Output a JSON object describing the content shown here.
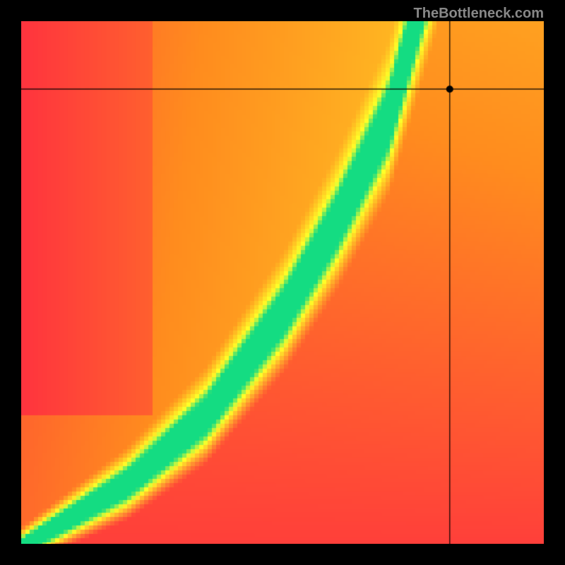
{
  "watermark": "TheBottleneck.com",
  "chart_data": {
    "type": "heatmap",
    "title": "",
    "xlabel": "",
    "ylabel": "",
    "xlim": [
      0,
      100
    ],
    "ylim": [
      0,
      100
    ],
    "colorscale": [
      {
        "value": 0,
        "color": "#ff2040"
      },
      {
        "value": 40,
        "color": "#ff8020"
      },
      {
        "value": 60,
        "color": "#ffff20"
      },
      {
        "value": 80,
        "color": "#10e080"
      },
      {
        "value": 100,
        "color": "#10e080"
      }
    ],
    "ridge": {
      "description": "Peak compatibility curve from bottom-left to upper area",
      "points": [
        {
          "x": 0,
          "y": 0
        },
        {
          "x": 20,
          "y": 12
        },
        {
          "x": 35,
          "y": 25
        },
        {
          "x": 50,
          "y": 45
        },
        {
          "x": 60,
          "y": 62
        },
        {
          "x": 70,
          "y": 82
        },
        {
          "x": 75,
          "y": 100
        }
      ]
    },
    "marker": {
      "x": 82,
      "y": 87
    },
    "crosshair": {
      "x": 82,
      "y": 87
    }
  }
}
